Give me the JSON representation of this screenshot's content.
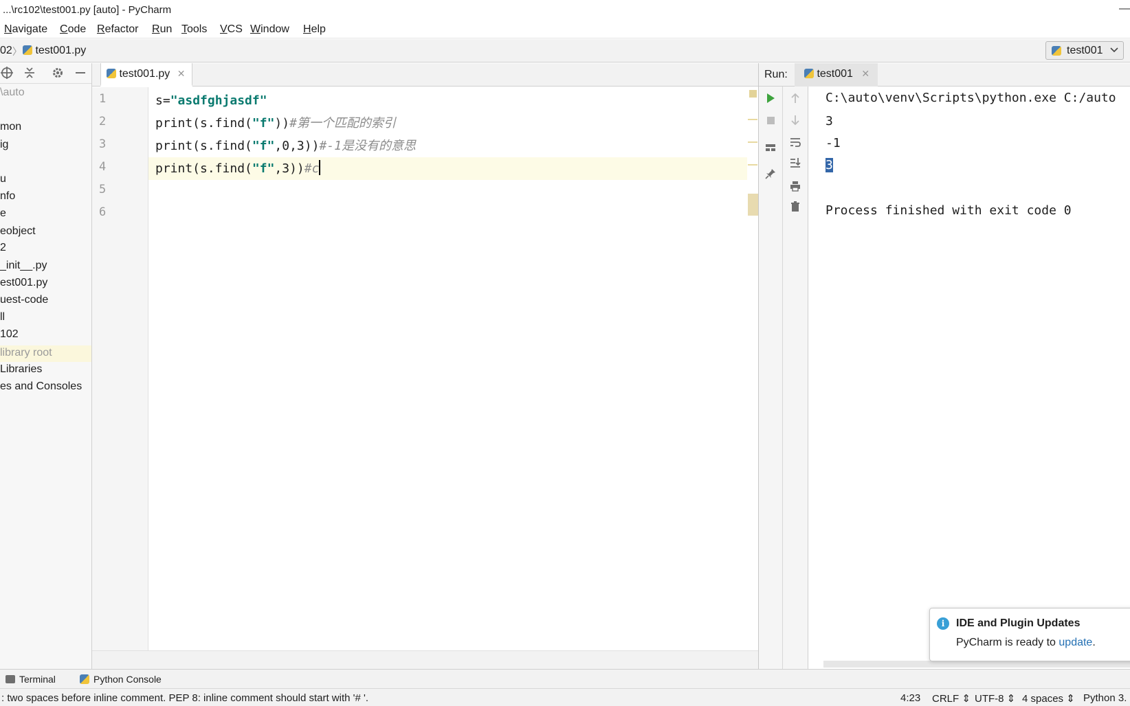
{
  "window": {
    "title": "...\\rc102\\test001.py [auto] - PyCharm",
    "minimize_glyph": "—"
  },
  "menu": [
    {
      "label": "Navigate",
      "mnemonic": "N",
      "rest": "avigate"
    },
    {
      "label": "Code",
      "mnemonic": "C",
      "rest": "ode"
    },
    {
      "label": "Refactor",
      "mnemonic": "R",
      "rest": "efactor"
    },
    {
      "label": "Run",
      "mnemonic": "R",
      "rest": "un"
    },
    {
      "label": "Tools",
      "mnemonic": "T",
      "rest": "ools"
    },
    {
      "label": "VCS",
      "mnemonic": "V",
      "rest": "CS"
    },
    {
      "label": "Window",
      "mnemonic": "W",
      "rest": "indow"
    },
    {
      "label": "Help",
      "mnemonic": "H",
      "rest": "elp"
    }
  ],
  "navbar": {
    "crumb_prev": "02",
    "crumb_sep": "〉",
    "crumb_file": "test001.py",
    "run_config": "test001"
  },
  "project_tree": [
    {
      "label": "\\auto",
      "dim": true
    },
    {
      "label": "mon"
    },
    {
      "label": "ig"
    },
    {
      "label": "u"
    },
    {
      "label": "nfo"
    },
    {
      "label": "e"
    },
    {
      "label": "eobject"
    },
    {
      "label": "2"
    },
    {
      "label": "_init__.py"
    },
    {
      "label": "est001.py"
    },
    {
      "label": "uest-code"
    },
    {
      "label": "ll"
    },
    {
      "label": "102"
    },
    {
      "label": " library root",
      "highlight": true
    },
    {
      "label": " Libraries"
    },
    {
      "label": "es and Consoles"
    }
  ],
  "editor": {
    "tab_label": "test001.py",
    "line_numbers": [
      "1",
      "2",
      "3",
      "4",
      "5",
      "6"
    ],
    "lines": [
      {
        "pre": "s=",
        "str": "\"asdfghjasdf\"",
        "post": "",
        "comment": ""
      },
      {
        "pre": "print(s.find(",
        "str": "\"f\"",
        "post": "))",
        "comment": "#第一个匹配的索引"
      },
      {
        "pre": "print(s.find(",
        "str": "\"f\"",
        "post": ",0,3))",
        "comment": "#-1是没有的意思"
      },
      {
        "pre": "print(s.find(",
        "str": "\"f\"",
        "post": ",3))",
        "comment": "#c"
      }
    ]
  },
  "run": {
    "label": "Run:",
    "tab_label": "test001",
    "output": [
      "C:\\auto\\venv\\Scripts\\python.exe C:/auto",
      "3",
      "-1",
      "3",
      "",
      "Process finished with exit code 0"
    ]
  },
  "notification": {
    "title": "IDE and Plugin Updates",
    "body_prefix": "PyCharm is ready to ",
    "link": "update",
    "body_suffix": "."
  },
  "bottom_tools": {
    "terminal": "Terminal",
    "python_console": "Python Console"
  },
  "status": {
    "message": ": two spaces before inline comment. PEP 8: inline comment should start with '# '.",
    "position": "4:23",
    "line_sep": "CRLF ⇕",
    "encoding": "UTF-8 ⇕",
    "indent": "4 spaces ⇕",
    "interpreter": "Python 3."
  },
  "icons": {
    "locate": "target-icon",
    "collapse": "collapse-icon",
    "settings": "gear-icon",
    "hide": "minimize-icon",
    "run": "play-icon",
    "stop": "stop-icon",
    "info": "info-icon"
  },
  "colors": {
    "string": "#0a7a6f",
    "comment": "#8c8c8c",
    "current_line": "#fdfbe6",
    "selection": "#3366a8",
    "link": "#2470b3",
    "run_green": "#3ea33e"
  }
}
